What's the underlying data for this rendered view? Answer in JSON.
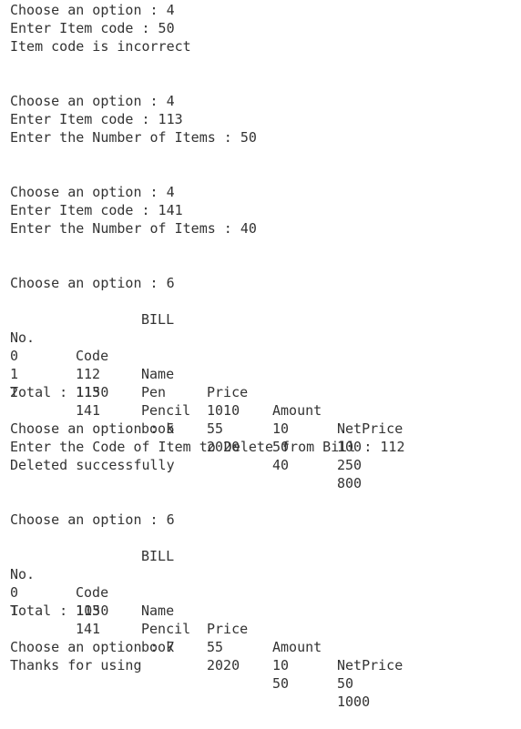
{
  "session": {
    "block1": {
      "option": "Choose an option : 4",
      "code": "Enter Item code : 50",
      "message": "Item code is incorrect"
    },
    "block2": {
      "option": "Choose an option : 4",
      "code": "Enter Item code : 113",
      "count": "Enter the Number of Items : 50"
    },
    "block3": {
      "option": "Choose an option : 4",
      "code": "Enter Item code : 141",
      "count": "Enter the Number of Items : 40"
    },
    "bill1": {
      "option": "Choose an option : 6",
      "title": "BILL",
      "headers": [
        "No.",
        "Code",
        "Name",
        "Price",
        "Amount",
        "NetPrice"
      ],
      "rows": [
        [
          "0",
          "112",
          "Pen",
          "1010",
          "10",
          "100"
        ],
        [
          "1",
          "113",
          "Pencil",
          "55",
          "50",
          "250"
        ],
        [
          "2",
          "141",
          "book",
          "2020",
          "40",
          "800"
        ]
      ],
      "total": "Total : 1150"
    },
    "delete": {
      "option": "Choose an option : 5",
      "prompt": "Enter the Code of Item to Delete from Bill : 112",
      "message": "Deleted successfully"
    },
    "bill2": {
      "option": "Choose an option : 6",
      "title": "BILL",
      "headers": [
        "No.",
        "Code",
        "Name",
        "Price",
        "Amount",
        "NetPrice"
      ],
      "rows": [
        [
          "0",
          "113",
          "Pencil",
          "55",
          "10",
          "50"
        ],
        [
          "1",
          "141",
          "book",
          "2020",
          "50",
          "1000"
        ]
      ],
      "total": "Total : 1050"
    },
    "exit": {
      "option": "Choose an option : 7",
      "message": "Thanks for using"
    }
  }
}
